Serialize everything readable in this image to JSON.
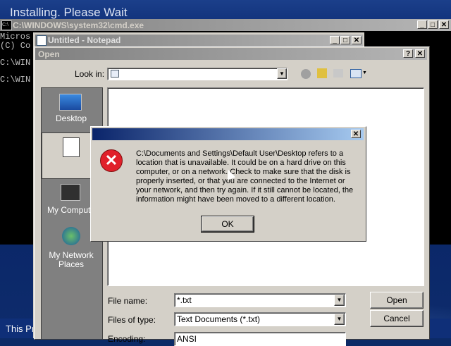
{
  "setup": {
    "title": "Installing. Please Wait",
    "bottom_text": "This Pr"
  },
  "cmd": {
    "title": "C:\\WINDOWS\\system32\\cmd.exe",
    "lines": [
      "Micros",
      "(C) Co",
      "",
      "C:\\WIN",
      "",
      "C:\\WIN"
    ]
  },
  "notepad": {
    "title": "Untitled - Notepad"
  },
  "open_dialog": {
    "title": "Open",
    "look_in_label": "Look in:",
    "places": [
      "Desktop",
      "",
      "My Compute",
      "My Network Places"
    ],
    "file_name_label": "File name:",
    "file_name_value": "*.txt",
    "files_of_type_label": "Files of type:",
    "files_of_type_value": "Text Documents (*.txt)",
    "encoding_label": "Encoding:",
    "encoding_value": "ANSI",
    "open_button": "Open",
    "cancel_button": "Cancel"
  },
  "error_dialog": {
    "message": "C:\\Documents and Settings\\Default User\\Desktop refers to a location that is unavailable. It could be on a hard drive on this computer, or on a network. Check to make sure that the disk is properly inserted, or that you are connected to the Internet or your network, and then try again. If it still cannot be located, the information might have been moved to a different location.",
    "ok_button": "OK"
  },
  "colors": {
    "error_icon": "#e0202a",
    "title_active": "#0a246a",
    "face": "#d4d0c8"
  }
}
